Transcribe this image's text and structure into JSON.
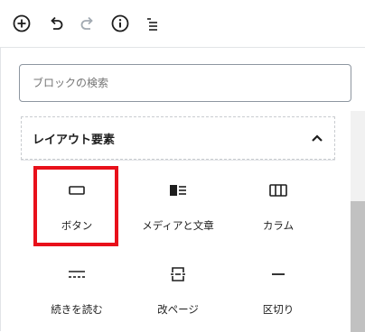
{
  "toolbar": {
    "icons": [
      "add-block-icon",
      "undo-icon",
      "redo-icon",
      "info-icon",
      "outline-icon"
    ]
  },
  "search": {
    "placeholder": "ブロックの検索"
  },
  "category": {
    "title": "レイアウト要素",
    "expanded": true
  },
  "blocks": [
    {
      "label": "ボタン",
      "icon": "button-icon",
      "highlighted": true
    },
    {
      "label": "メディアと文章",
      "icon": "media-text-icon"
    },
    {
      "label": "カラム",
      "icon": "columns-icon"
    },
    {
      "label": "続きを読む",
      "icon": "more-icon"
    },
    {
      "label": "改ページ",
      "icon": "page-break-icon"
    },
    {
      "label": "区切り",
      "icon": "separator-icon"
    }
  ],
  "colors": {
    "highlight": "#e8101a",
    "icon": "#1e1e1e",
    "disabled_icon": "#a2aab2",
    "border": "#8d96a0"
  }
}
